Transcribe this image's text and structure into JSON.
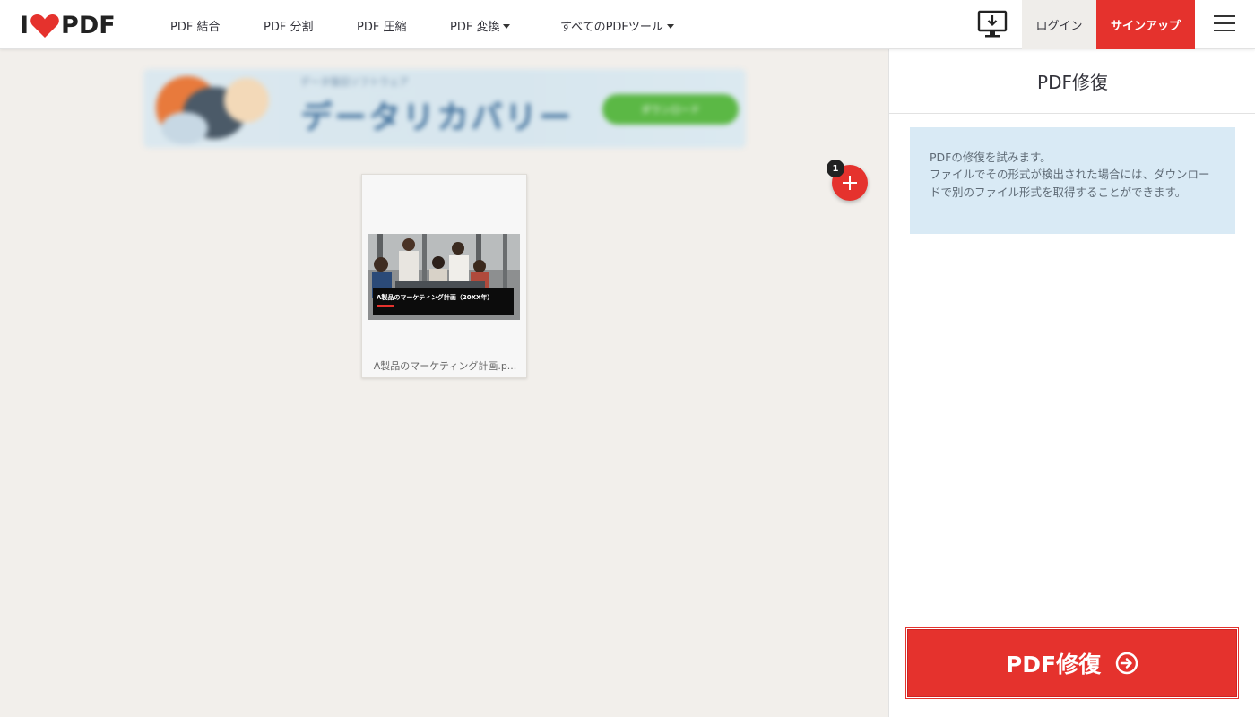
{
  "header": {
    "logo_left": "I",
    "logo_right": "PDF",
    "nav": [
      {
        "label": "PDF 結合",
        "dropdown": false
      },
      {
        "label": "PDF 分割",
        "dropdown": false
      },
      {
        "label": "PDF 圧縮",
        "dropdown": false
      },
      {
        "label": "PDF 変換",
        "dropdown": true
      },
      {
        "label": "すべてのPDFツール",
        "dropdown": true
      }
    ],
    "login_label": "ログイン",
    "signup_label": "サインアップ",
    "icons": [
      "heart-logo-icon",
      "desktop-download-icon",
      "hamburger-menu-icon"
    ]
  },
  "main": {
    "ad": {
      "headline": "データリカバリー",
      "subline": "データ復旧ソフトウェア",
      "cta": "ダウンロード"
    },
    "add_file_count": "1",
    "files": [
      {
        "name": "A製品のマーケティング計画.p...",
        "thumb_caption": "A製品のマーケティング計画（20XX年）"
      }
    ]
  },
  "sidebar": {
    "title": "PDF修復",
    "info_line1": "PDFの修復を試みます。",
    "info_line2": "ファイルでその形式が検出された場合には、ダウンロードで別のファイル形式を取得することができます。",
    "action_label": "PDF修復"
  },
  "colors": {
    "brand_red": "#e5322d",
    "info_bg": "#d9eaf5",
    "page_bg": "#f2efeb"
  }
}
